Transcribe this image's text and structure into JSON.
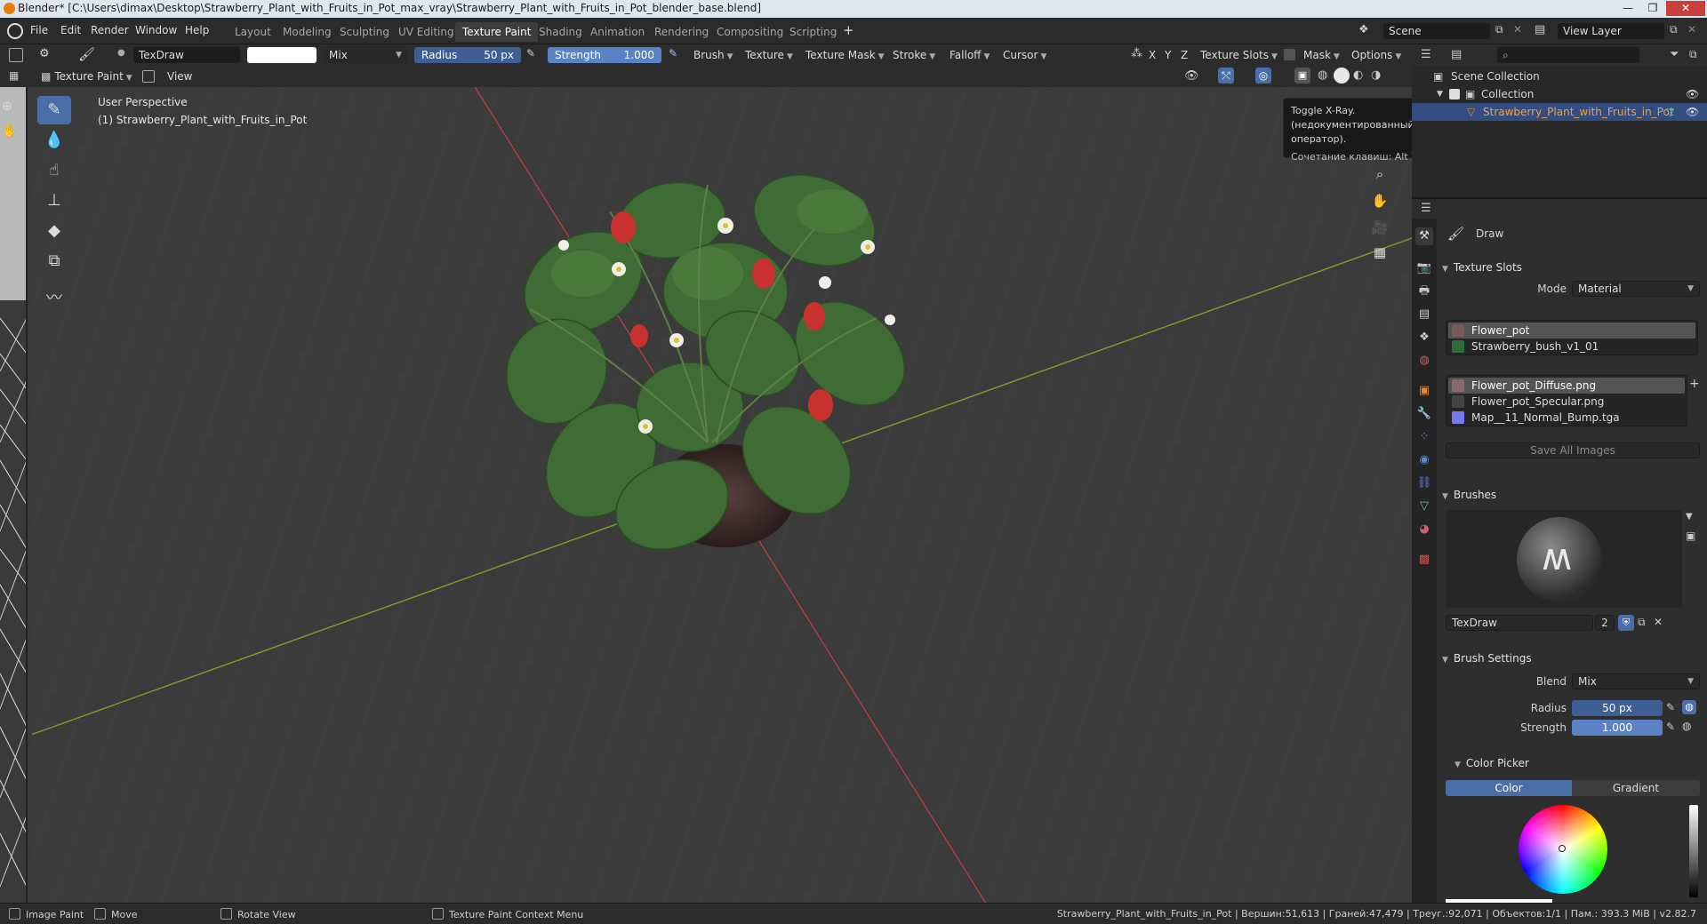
{
  "window": {
    "title": "Blender* [C:\\Users\\dimax\\Desktop\\Strawberry_Plant_with_Fruits_in_Pot_max_vray\\Strawberry_Plant_with_Fruits_in_Pot_blender_base.blend]",
    "minimize": "—",
    "maximize": "❐",
    "close": "✕"
  },
  "menu": [
    "File",
    "Edit",
    "Render",
    "Window",
    "Help"
  ],
  "workspaces": [
    "Layout",
    "Modeling",
    "Sculpting",
    "UV Editing",
    "Texture Paint",
    "Shading",
    "Animation",
    "Rendering",
    "Compositing",
    "Scripting"
  ],
  "workspace_active": "Texture Paint",
  "workspace_add": "+",
  "scene": {
    "name": "Scene",
    "view_layer": "View Layer"
  },
  "tool_header": {
    "brush_name": "TexDraw",
    "blend": "Mix",
    "radius_label": "Radius",
    "radius_value": "50 px",
    "strength_label": "Strength",
    "strength_value": "1.000",
    "menus": [
      "Brush",
      "Texture",
      "Texture Mask",
      "Stroke",
      "Falloff",
      "Cursor"
    ],
    "axes": [
      "X",
      "Y",
      "Z"
    ],
    "texture_slots": "Texture Slots",
    "mask": "Mask",
    "options": "Options"
  },
  "mode_header": {
    "mode": "Texture Paint",
    "view": "View"
  },
  "viewport": {
    "perspective": "User Perspective",
    "object_label": "(1) Strawberry_Plant_with_Fruits_in_Pot",
    "tooltip": {
      "line1": "Toggle X-Ray.",
      "line2": "(недокументированный оператор).",
      "line3": "Сочетание клавиш: Alt Z"
    }
  },
  "outliner": {
    "scene_collection": "Scene Collection",
    "collection": "Collection",
    "object": "Strawberry_Plant_with_Fruits_in_Pot"
  },
  "properties": {
    "tool_name": "Draw",
    "texture_slots": {
      "title": "Texture Slots",
      "mode_label": "Mode",
      "mode_value": "Material",
      "materials": [
        "Flower_pot",
        "Strawberry_bush_v1_01"
      ],
      "images": [
        "Flower_pot_Diffuse.png",
        "Flower_pot_Specular.png",
        "Map__11_Normal_Bump.tga"
      ],
      "save_all": "Save All Images"
    },
    "brushes": {
      "title": "Brushes",
      "brush_name": "TexDraw",
      "users": "2"
    },
    "brush_settings": {
      "title": "Brush Settings",
      "blend_label": "Blend",
      "blend_value": "Mix",
      "radius_label": "Radius",
      "radius_value": "50 px",
      "strength_label": "Strength",
      "strength_value": "1.000"
    },
    "color_picker": {
      "title": "Color Picker",
      "tab_color": "Color",
      "tab_gradient": "Gradient"
    }
  },
  "status": {
    "image_paint": "Image Paint",
    "move": "Move",
    "rotate_view": "Rotate View",
    "context_menu": "Texture Paint Context Menu",
    "stats": "Strawberry_Plant_with_Fruits_in_Pot | Вершин:51,613 | Граней:47,479 | Треуг.:92,071 | Объектов:1/1 | Пам.: 393.3 MiB | v2.82.7"
  },
  "colors": {
    "accent": "#5a82c4",
    "viewport_bg": "#3b3b3b",
    "x_axis": "#b83a44",
    "y_axis": "#7ca12a",
    "outliner_highlight": "#e08a2c"
  }
}
